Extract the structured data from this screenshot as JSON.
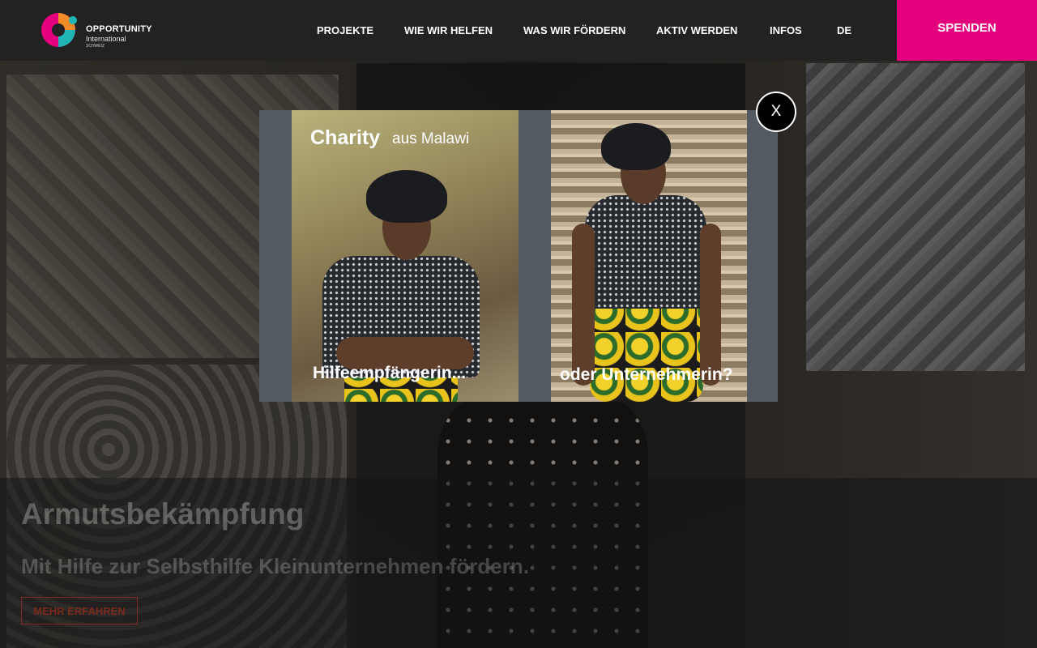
{
  "header": {
    "logo": {
      "name": "OPPORTUNITY",
      "line2": "International",
      "line3": "SCHWEIZ"
    },
    "nav": [
      {
        "label": "PROJEKTE"
      },
      {
        "label": "WIE WIR HELFEN"
      },
      {
        "label": "WAS WIR FÖRDERN"
      },
      {
        "label": "AKTIV WERDEN"
      },
      {
        "label": "INFOS"
      },
      {
        "label": "DE"
      }
    ],
    "donate_label": "SPENDEN"
  },
  "hero": {
    "title": "Armutsbekämpfung",
    "subtitle": "Mit Hilfe zur Selbsthilfe Kleinunternehmen fördern.",
    "button_label": "MEHR ERFAHREN"
  },
  "modal": {
    "heading": "Charity",
    "heading_sub": "aus Malawi",
    "caption_left": "Hilfeempfängerin...",
    "caption_right": "oder Unternehmerin?",
    "close_label": "X"
  },
  "colors": {
    "header_bg": "#222222",
    "donate_bg": "#e5007e",
    "modal_bg": "#535a61",
    "logo_magenta": "#e5007e",
    "logo_teal": "#1fb5b5",
    "logo_orange": "#f28c28"
  }
}
